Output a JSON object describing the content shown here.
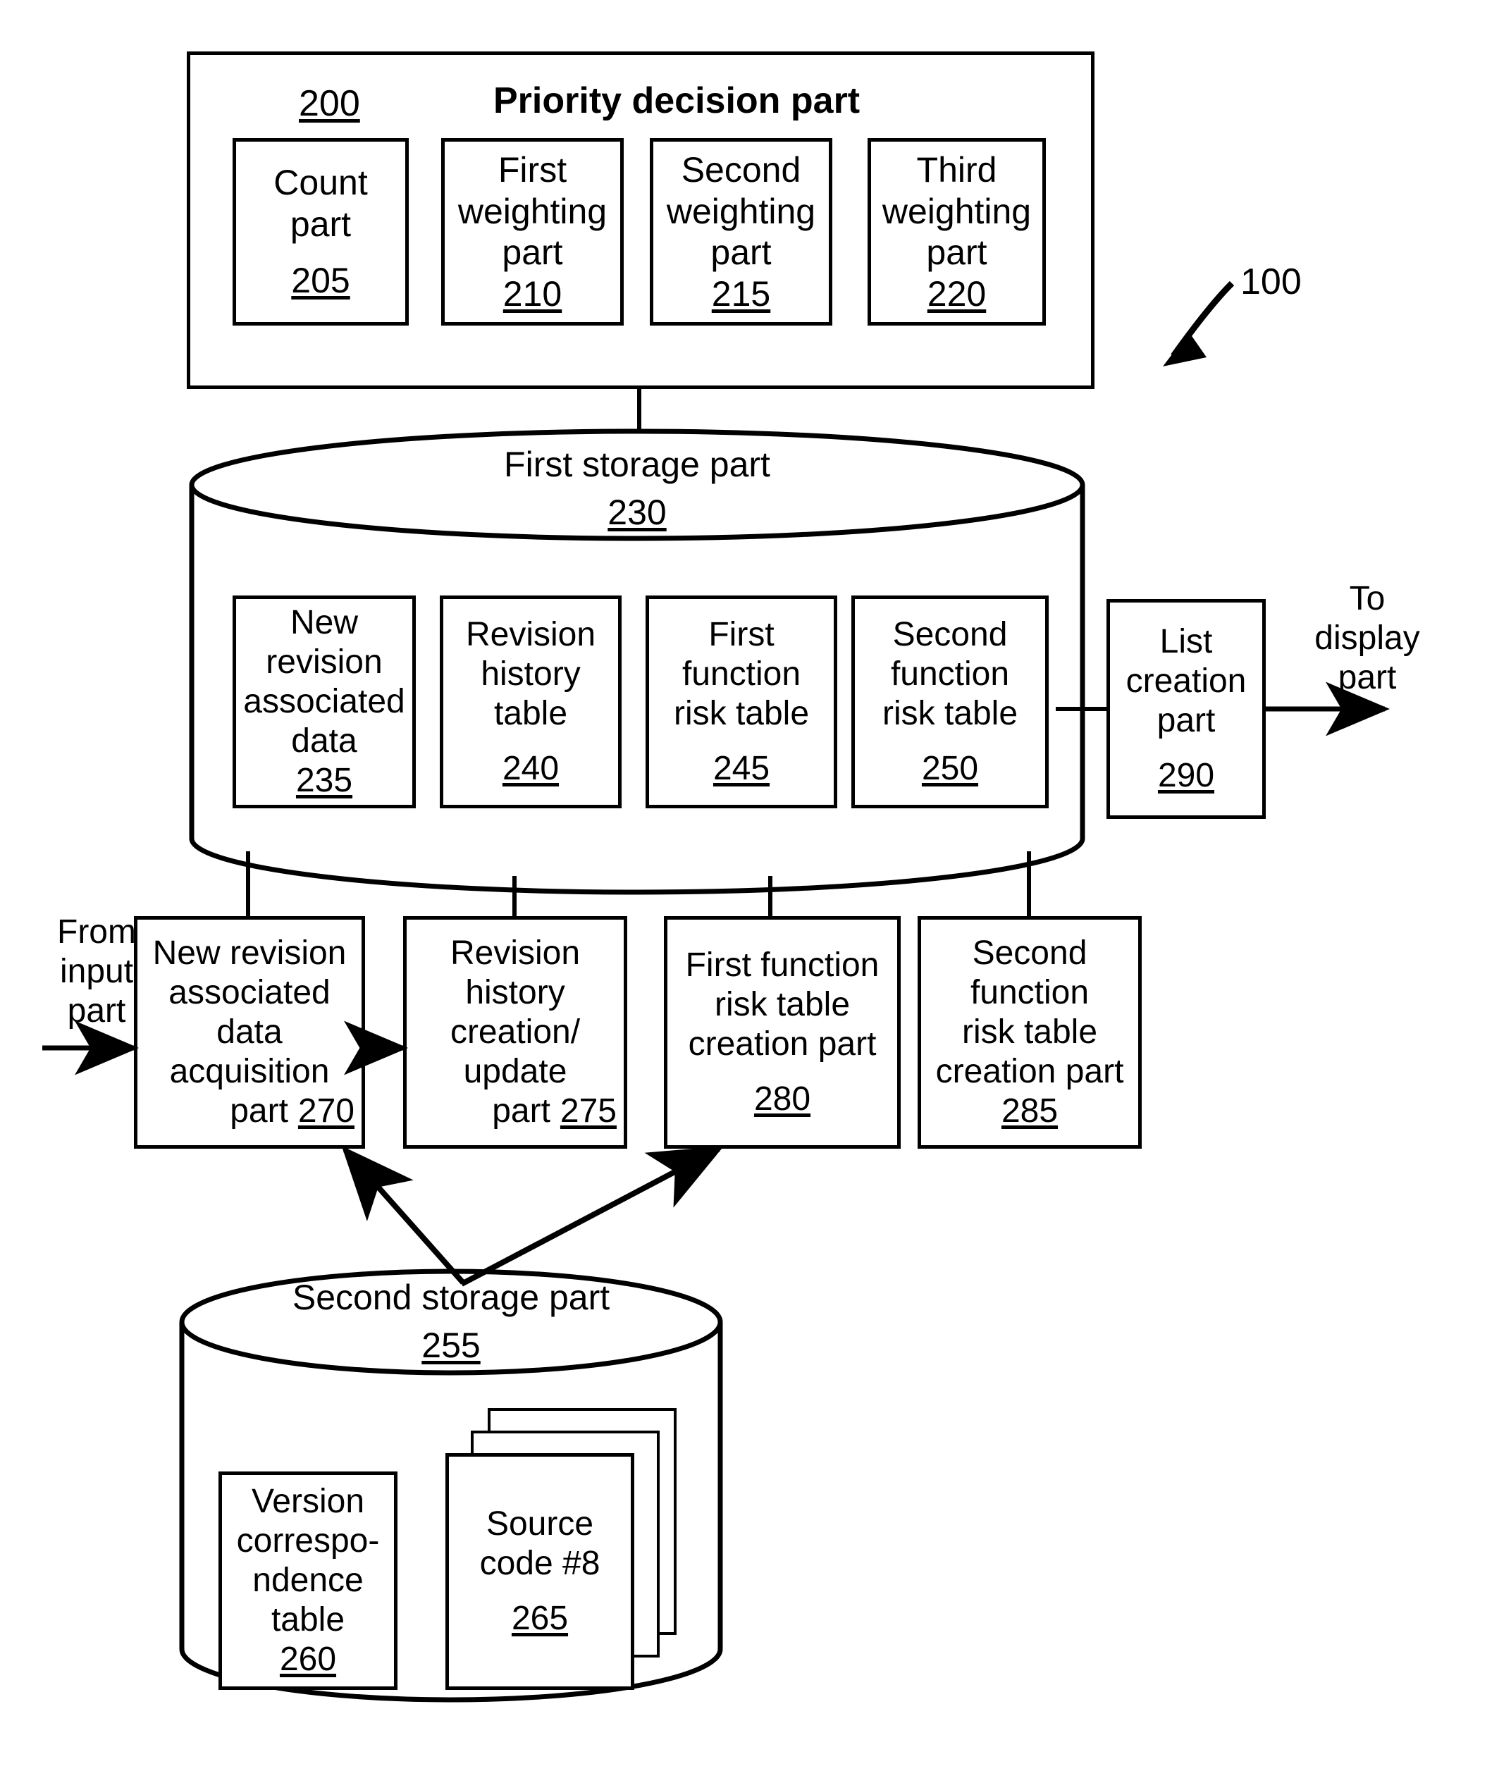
{
  "figure": {
    "system_ref": "100",
    "priority_block": {
      "ref": "200",
      "title": "Priority decision part",
      "parts": [
        {
          "name": "Count\npart",
          "ref": "205",
          "data_name": "count-part-box"
        },
        {
          "name": "First\nweighting\npart",
          "ref": "210",
          "data_name": "first-weighting-part-box"
        },
        {
          "name": "Second\nweighting\npart",
          "ref": "215",
          "data_name": "second-weighting-part-box"
        },
        {
          "name": "Third\nweighting\npart",
          "ref": "220",
          "data_name": "third-weighting-part-box"
        }
      ]
    },
    "first_storage": {
      "title": "First storage part",
      "ref": "230",
      "items": [
        {
          "name": "New\nrevision\nassociated\ndata",
          "ref": "235",
          "data_name": "new-revision-associated-data-box"
        },
        {
          "name": "Revision\nhistory\ntable",
          "ref": "240",
          "data_name": "revision-history-table-box"
        },
        {
          "name": "First\nfunction\nrisk table",
          "ref": "245",
          "data_name": "first-function-risk-table-box"
        },
        {
          "name": "Second\nfunction\nrisk table",
          "ref": "250",
          "data_name": "second-function-risk-table-box"
        }
      ]
    },
    "list_creation": {
      "name": "List\ncreation\npart",
      "ref": "290",
      "output_label": "To\ndisplay\npart"
    },
    "input_label": "From\ninput\npart",
    "process_parts": [
      {
        "name": "New revision\nassociated\ndata\nacquisition",
        "tail": "part",
        "ref": "270",
        "data_name": "new-revision-associated-data-acquisition-part-box"
      },
      {
        "name": "Revision\nhistory\ncreation/\nupdate",
        "tail": "part",
        "ref": "275",
        "data_name": "revision-history-creation-update-part-box"
      },
      {
        "name": "First function\nrisk table\ncreation part",
        "tail": "",
        "ref": "280",
        "data_name": "first-function-risk-table-creation-part-box"
      },
      {
        "name": "Second\nfunction\nrisk table\ncreation part",
        "tail": "",
        "ref": "285",
        "data_name": "second-function-risk-table-creation-part-box"
      }
    ],
    "second_storage": {
      "title": "Second storage part",
      "ref": "255",
      "items": [
        {
          "name": "Version\ncorrespo-\nndence\ntable",
          "ref": "260",
          "data_name": "version-correspondence-table-box"
        },
        {
          "name": "Source\ncode #8",
          "ref": "265",
          "data_name": "source-code-stack-box"
        }
      ]
    },
    "colors": {
      "ink": "#000000",
      "paper": "#ffffff"
    }
  }
}
